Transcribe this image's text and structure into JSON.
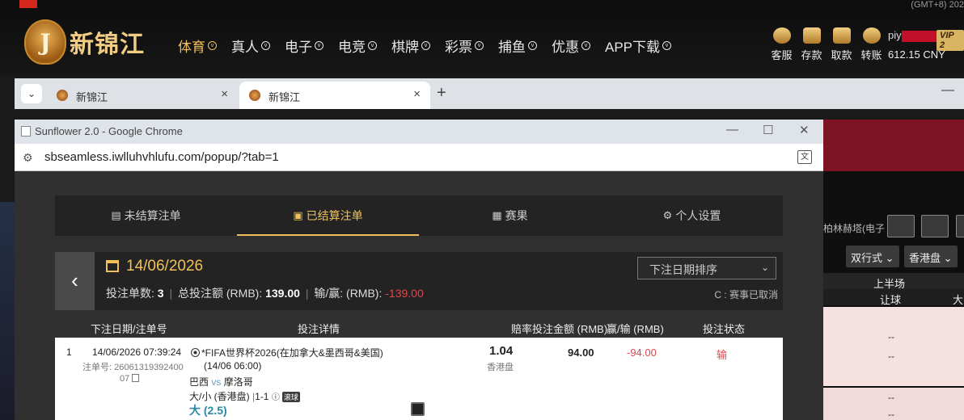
{
  "site": {
    "timezone": "(GMT+8) 202",
    "logo_text": "新锦江",
    "logo_letter": "J",
    "nav": [
      {
        "label": "体育",
        "active": true
      },
      {
        "label": "真人",
        "active": false
      },
      {
        "label": "电子",
        "active": false
      },
      {
        "label": "电竞",
        "active": false
      },
      {
        "label": "棋牌",
        "active": false
      },
      {
        "label": "彩票",
        "active": false
      },
      {
        "label": "捕鱼",
        "active": false
      },
      {
        "label": "优惠",
        "active": false
      },
      {
        "label": "APP下载",
        "active": false
      }
    ],
    "actions": [
      {
        "label": "客服",
        "icon": "customer-service-icon"
      },
      {
        "label": "存款",
        "icon": "wallet-deposit-icon"
      },
      {
        "label": "取款",
        "icon": "wallet-withdraw-icon"
      },
      {
        "label": "转账",
        "icon": "transfer-coin-icon"
      }
    ],
    "user_prefix": "piy",
    "vip": "VIP 2",
    "balance": "612.15 CNY",
    "search_text": "柏林赫塔(电子",
    "odds_type": "双行式",
    "market_type": "香港盘",
    "first_half": "上半场",
    "handicap": "让球",
    "big": "大",
    "dashes": "--"
  },
  "browser": {
    "tabs": [
      {
        "title": "新锦江",
        "active": false
      },
      {
        "title": "新锦江",
        "active": true
      }
    ],
    "new_tab": "+",
    "close": "×",
    "minimize": "—"
  },
  "popup": {
    "window_title": "Sunflower 2.0 - Google Chrome",
    "url": "sbseamless.iwlluhvhlufu.com/popup/?tab=1",
    "tabs": [
      {
        "label": "未结算注单",
        "icon": "unsettled-list-icon",
        "active": false
      },
      {
        "label": "已结算注单",
        "icon": "settled-list-icon",
        "active": true
      },
      {
        "label": "赛果",
        "icon": "scoreboard-icon",
        "active": false
      },
      {
        "label": "个人设置",
        "icon": "gear-icon",
        "active": false
      }
    ],
    "summary": {
      "date": "14/06/2026",
      "bet_count_label": "投注单数:",
      "bet_count": "3",
      "total_label": "总投注额 (RMB):",
      "total": "139.00",
      "winloss_label": "输/赢: (RMB):",
      "winloss": "-139.00",
      "sort_label": "下注日期排序",
      "note": "C : 赛事已取消"
    },
    "table": {
      "headers": [
        "下注日期/注单号",
        "投注详情",
        "赔率",
        "投注金额 (RMB)",
        "赢/输 (RMB)",
        "投注状态"
      ],
      "rows": [
        {
          "index": "1",
          "datetime": "14/06/2026 07:39:24",
          "order_label": "注单号:",
          "order_no_1": "26061319392400",
          "order_no_2": "07",
          "league": "*FIFA世界杯2026(在加拿大&墨西哥&美国)",
          "match_time": "(14/06 06:00)",
          "home": "巴西",
          "vs": "vs",
          "away": "摩洛哥",
          "market": "大/小 (香港盘)",
          "score": "1-1",
          "live_tag": "滚球",
          "pick": "大 (2.5)",
          "odds": "1.04",
          "odds_type": "香港盘",
          "stake": "94.00",
          "winloss": "-94.00",
          "status": "输"
        }
      ]
    }
  }
}
